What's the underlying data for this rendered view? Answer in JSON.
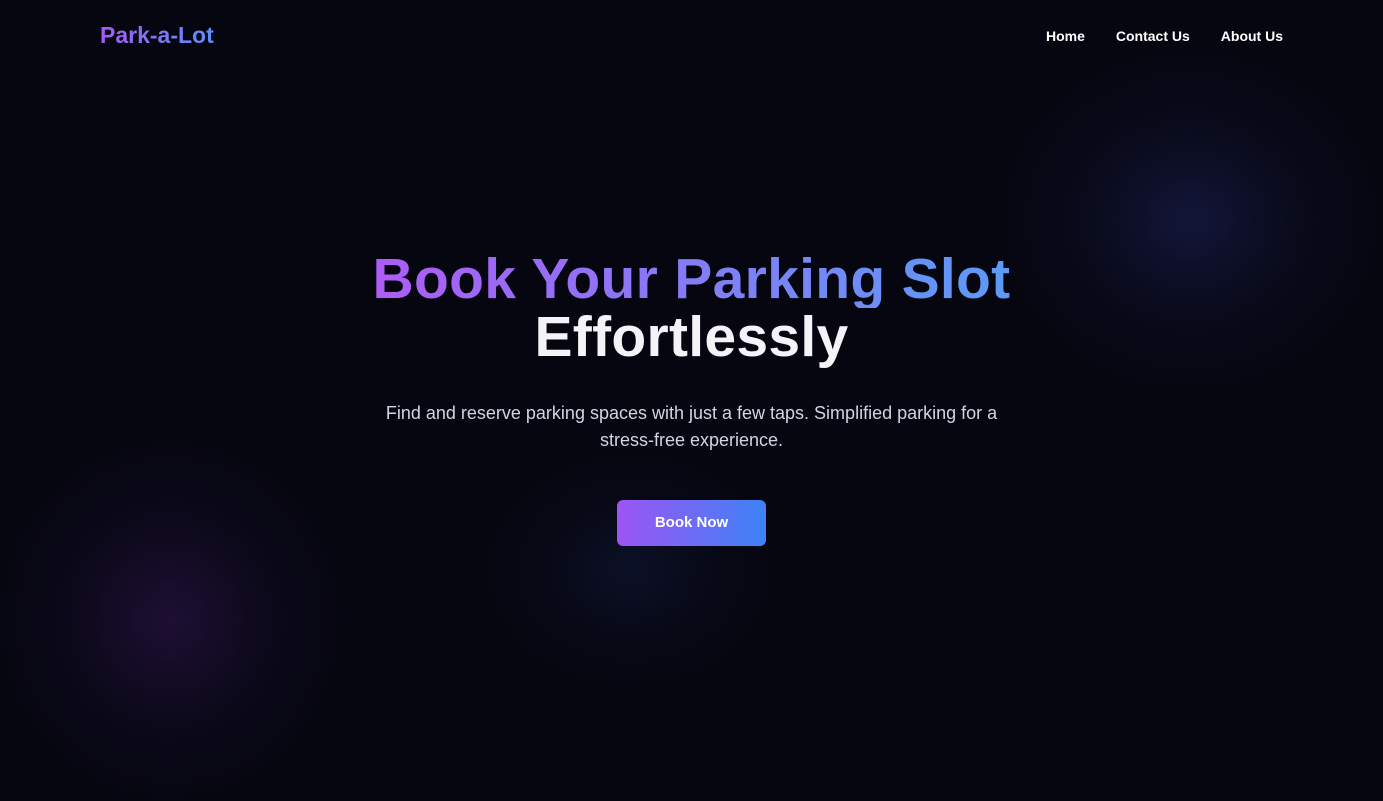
{
  "brand": {
    "name": "Park-a-Lot"
  },
  "nav": {
    "items": [
      {
        "label": "Home"
      },
      {
        "label": "Contact Us"
      },
      {
        "label": "About Us"
      }
    ]
  },
  "hero": {
    "title_accent": "Book Your Parking Slot",
    "title_plain": "Effortlessly",
    "subtitle": "Find and reserve parking spaces with just a few taps. Simplified parking for a stress-free experience.",
    "cta_label": "Book Now"
  },
  "colors": {
    "background": "#05060f",
    "gradient_start": "#a35cf5",
    "gradient_end": "#3d82f6",
    "text": "#ffffff",
    "subtitle_text": "#d2d4e2"
  }
}
